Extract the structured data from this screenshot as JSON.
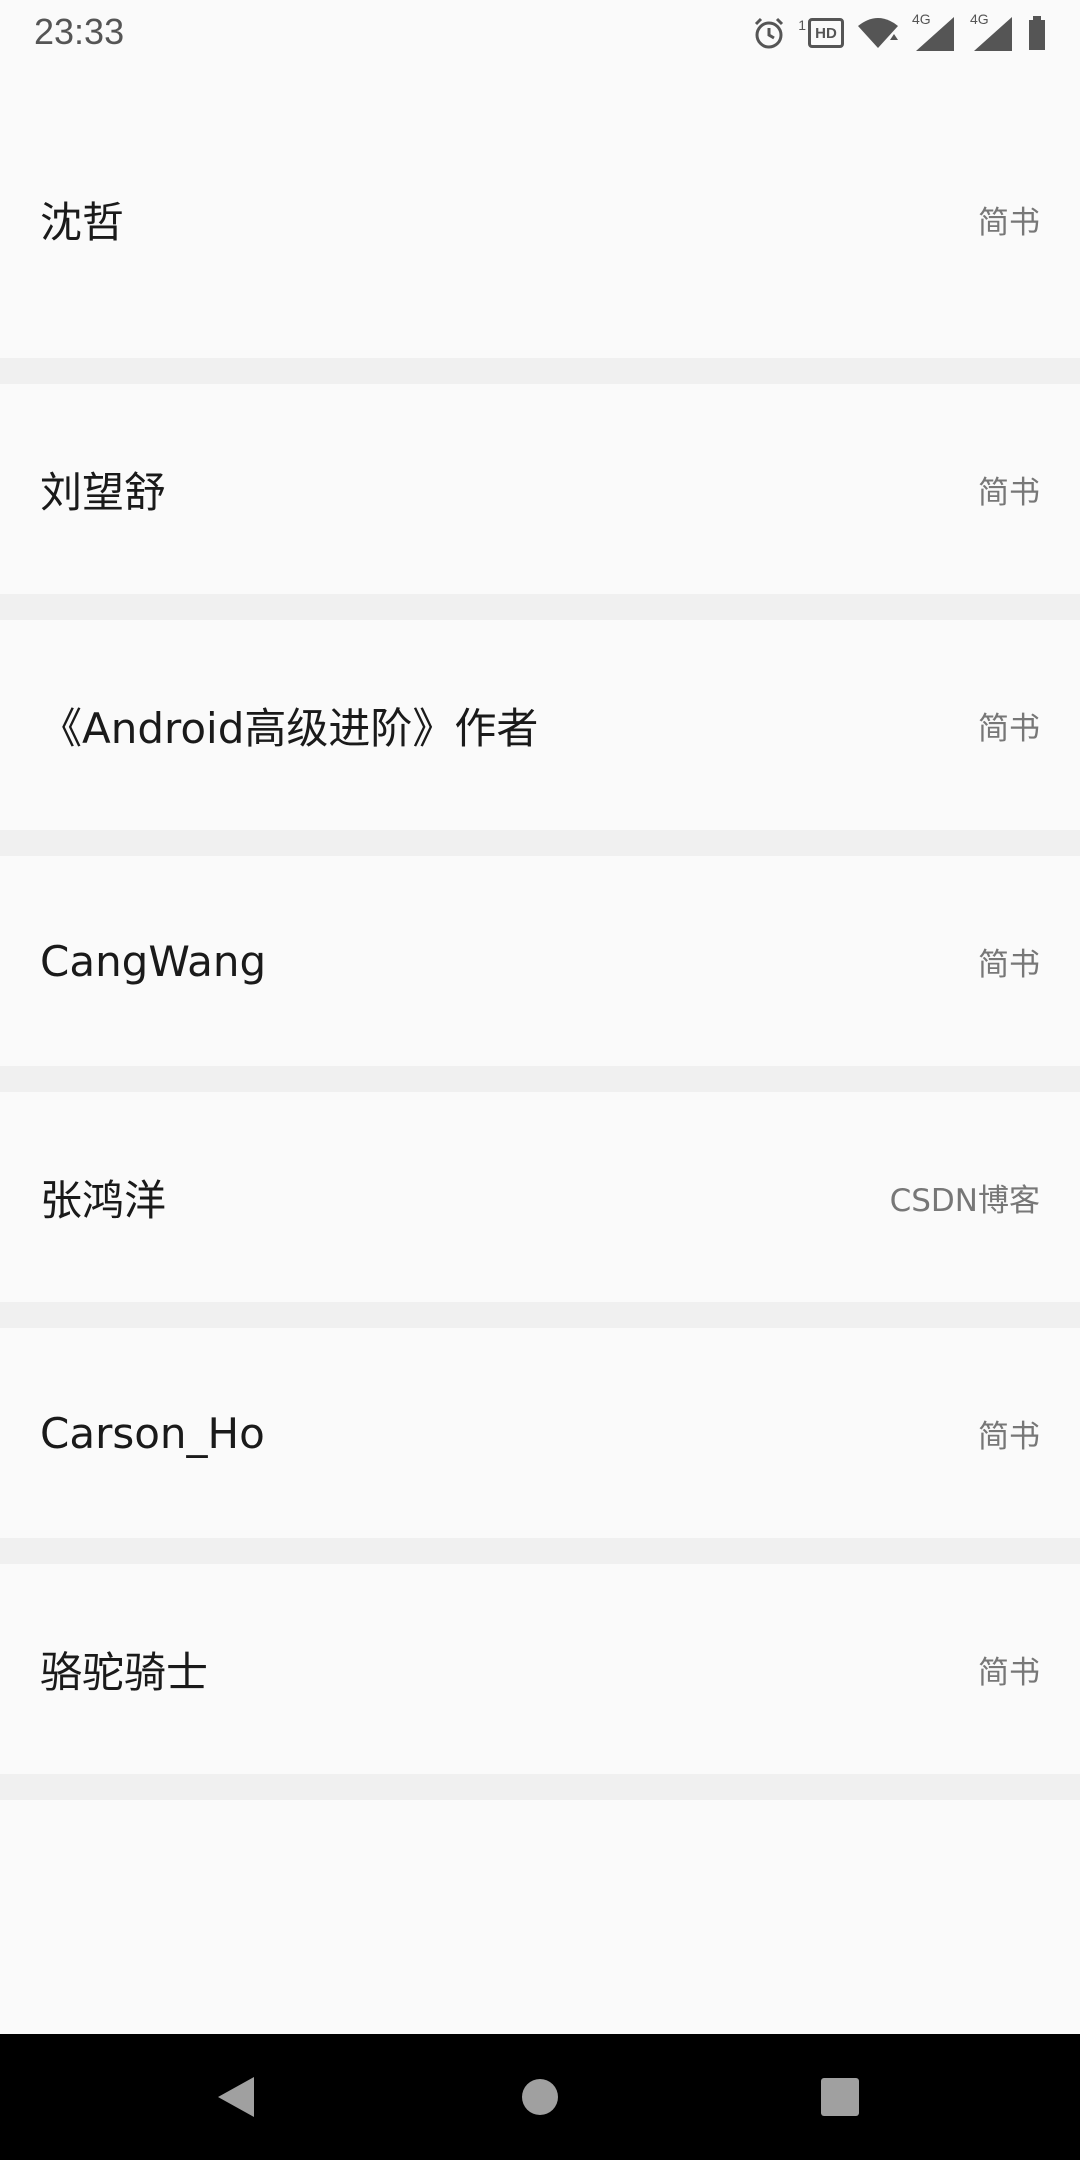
{
  "status_bar": {
    "time": "23:33",
    "icons": [
      "alarm-icon",
      "hd-icon",
      "wifi-icon",
      "signal-4g-icon",
      "signal-4g-icon",
      "battery-icon"
    ],
    "network_label": "4G",
    "hd_label": "HD",
    "sim_label": "1"
  },
  "items": [
    {
      "name": "沈哲",
      "source": "简书"
    },
    {
      "name": "刘望舒",
      "source": "简书"
    },
    {
      "name": "《Android高级进阶》作者",
      "source": "简书"
    },
    {
      "name": "CangWang",
      "source": "简书"
    },
    {
      "name": "张鸿洋",
      "source": "CSDN博客"
    },
    {
      "name": "Carson_Ho",
      "source": "简书"
    },
    {
      "name": "骆驼骑士",
      "source": "简书"
    }
  ],
  "nav_bar": {
    "buttons": [
      "back-icon",
      "home-icon",
      "recents-icon"
    ]
  },
  "colors": {
    "background": "#fafafa",
    "divider": "#f0f0f0",
    "text_primary": "#1a1a1a",
    "text_secondary": "#777777",
    "nav_bar": "#000000"
  }
}
